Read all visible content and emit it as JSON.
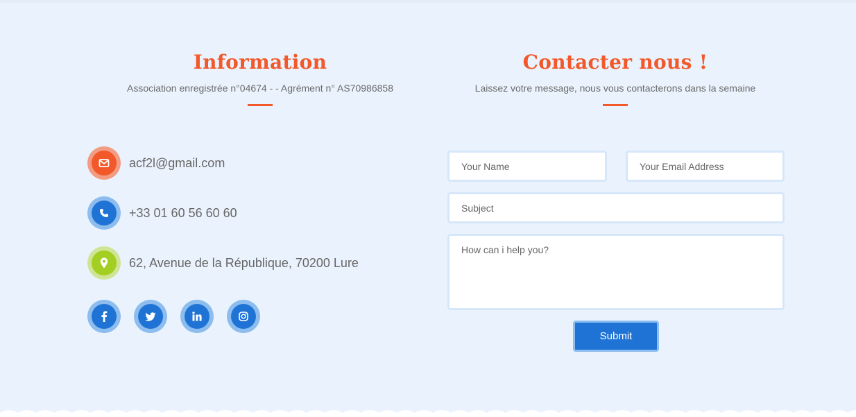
{
  "information": {
    "title": "Information",
    "subtitle": "Association enregistrée n°04674 - - Agrément n° AS70986858"
  },
  "contact": {
    "title": "Contacter nous !",
    "subtitle": "Laissez votre message, nous vous contacterons dans la semaine"
  },
  "info_items": {
    "email": {
      "text": "acf2l@gmail.com",
      "icon": "envelope-icon",
      "color": "#f2582a",
      "ring": "#f39c84"
    },
    "phone": {
      "text": "+33 01 60 56 60 60",
      "icon": "phone-icon",
      "color": "#1f73d4",
      "ring": "#8dbdee"
    },
    "address": {
      "text": "62, Avenue de la République, 70200 Lure",
      "icon": "map-pin-icon",
      "color": "#a3cf23",
      "ring": "#cfe494"
    }
  },
  "social": [
    "facebook-icon",
    "twitter-icon",
    "linkedin-icon",
    "instagram-icon"
  ],
  "form": {
    "name_placeholder": "Your Name",
    "email_placeholder": "Your Email Address",
    "subject_placeholder": "Subject",
    "message_placeholder": "How can i help you?",
    "submit_label": "Submit"
  },
  "colors": {
    "accent": "#f2582a",
    "primary": "#1f73d4",
    "background": "#eaf3fd"
  }
}
